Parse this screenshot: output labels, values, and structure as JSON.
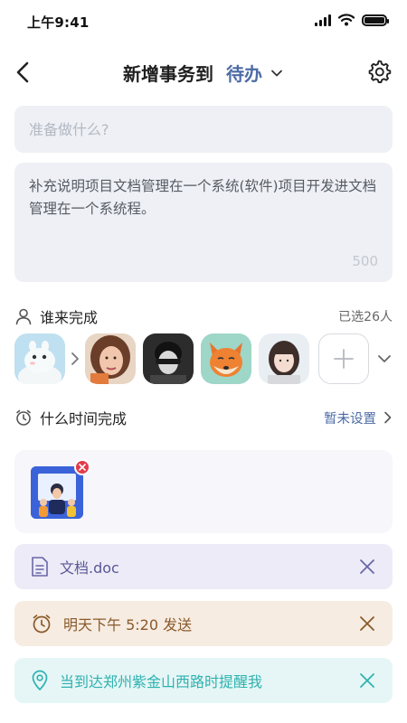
{
  "status_bar": {
    "time": "上午9:41"
  },
  "header": {
    "title": "新增事务到",
    "status_value": "待办"
  },
  "task_input": {
    "placeholder": "准备做什么?",
    "value": ""
  },
  "description": {
    "text": "补充说明项目文档管理在一个系统(软件)项目开发进文档管理在一个系统程。",
    "char_limit": "500"
  },
  "assignees": {
    "label": "谁来完成",
    "selected_count": "已选26人",
    "avatars": [
      "avatar-moomin",
      "avatar-woman-portrait",
      "avatar-man-bw",
      "avatar-fox-cartoon",
      "avatar-girl-snow"
    ]
  },
  "schedule": {
    "label": "什么时间完成",
    "value": "暂未设置"
  },
  "attachments": {
    "file_name": "文档.doc"
  },
  "reminder": {
    "time_text": "明天下午 5:20 发送",
    "location_text": "当到达郑州紫金山西路时提醒我"
  },
  "colors": {
    "accent": "#4d6ba6",
    "doc_pill": "#ecebf7",
    "time_pill": "#f6ece2",
    "location_pill": "#e6f6f6",
    "remove_badge": "#e23b4a"
  }
}
